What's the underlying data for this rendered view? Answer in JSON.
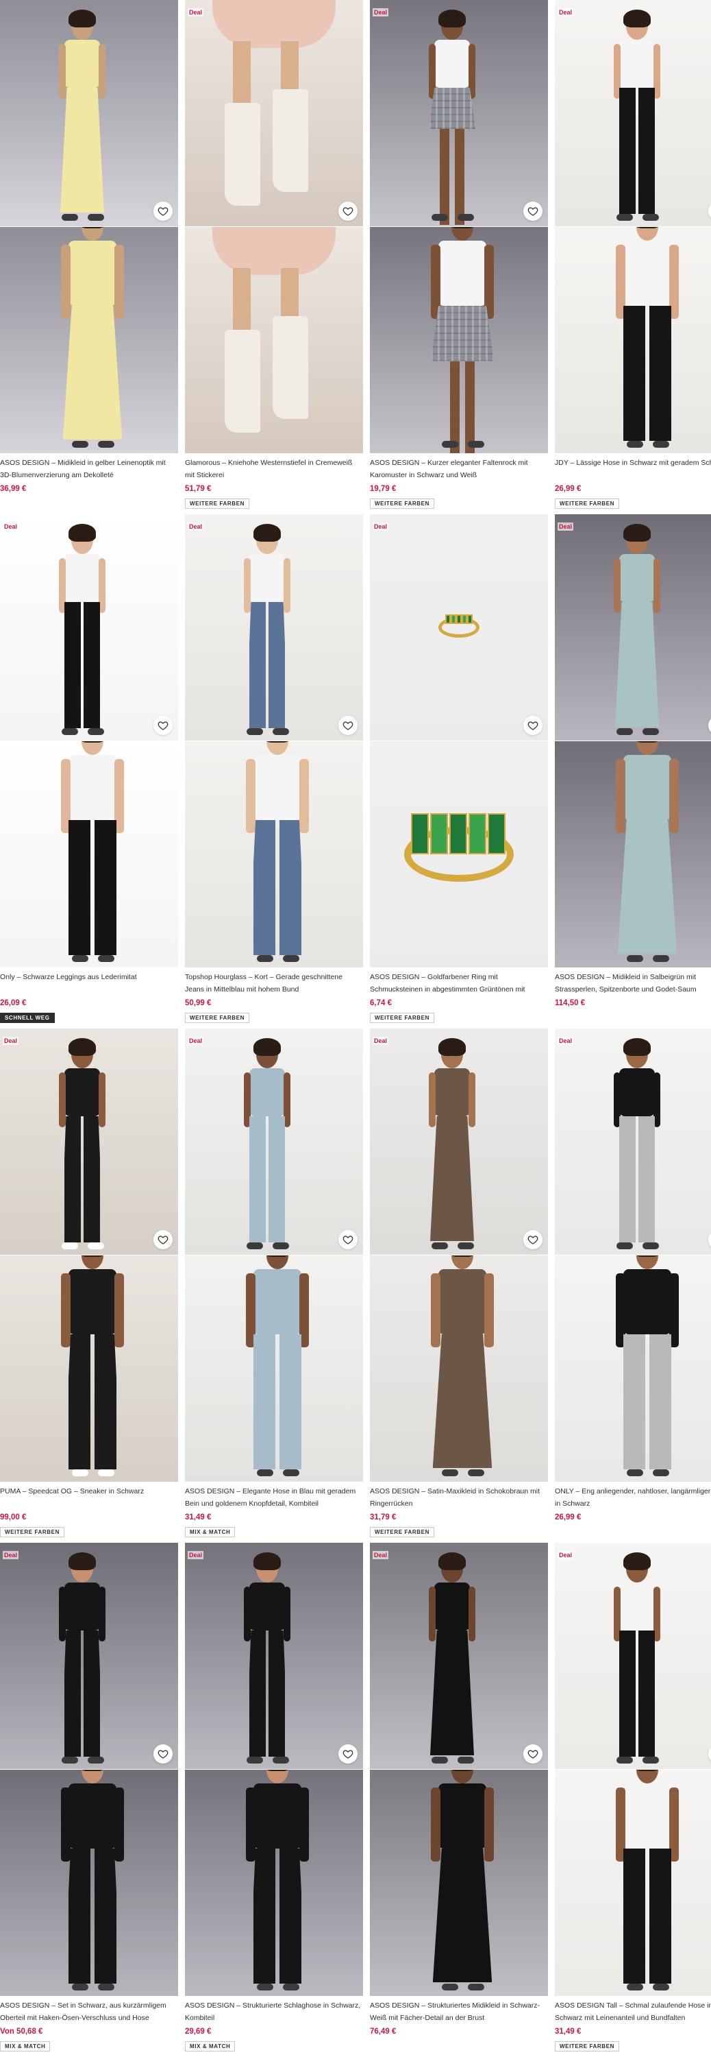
{
  "badge_label": "Deal",
  "icons": {
    "save": "heart-icon"
  },
  "colors": {
    "price": "#d01345",
    "text": "#2d2d2d"
  },
  "products": [
    {
      "id": 1,
      "deal": false,
      "title": "ASOS DESIGN – Midikleid in gelber Leinenoptik mit 3D-Blumenverzierung am Dekolleté",
      "price": "36,99 €",
      "tag": "",
      "bg": [
        "#8f8d96",
        "#d7d5da"
      ],
      "tone": "#f1e7a3",
      "skin": "#c9a07c",
      "style": "dress"
    },
    {
      "id": 2,
      "deal": true,
      "title": "Glamorous – Kniehohe Westernstiefel in Cremeweiß mit Stickerei",
      "price": "51,79 €",
      "tag": "WEITERE FARBEN",
      "bg": [
        "#ece6e1",
        "#d6c9be"
      ],
      "tone": "#f1ece4",
      "skin": "#d9b08e",
      "style": "boots"
    },
    {
      "id": 3,
      "deal": true,
      "title": "ASOS DESIGN – Kurzer eleganter Faltenrock mit Karomuster in Schwarz und Weiß",
      "price": "19,79 €",
      "tag": "WEITERE FARBEN",
      "bg": [
        "#77747d",
        "#c7c4cb"
      ],
      "tone": "#8d8f96",
      "skin": "#7b5236",
      "style": "skirt"
    },
    {
      "id": 4,
      "deal": true,
      "title": "JDY – Lässige Hose in Schwarz mit geradem Schnitt",
      "price": "26,99 €",
      "tag": "WEITERE FARBEN",
      "bg": [
        "#f6f5f3",
        "#e8e6e2"
      ],
      "tone": "#151515",
      "skin": "#d8a888",
      "style": "pants"
    },
    {
      "id": 5,
      "deal": true,
      "title": "Only – Schwarze Leggings aus Lederimitat",
      "price": "26,09 €",
      "tag": "SCHNELL WEG",
      "bg": [
        "#ffffff",
        "#f4f4f4"
      ],
      "tone": "#141414",
      "skin": "#e0b899",
      "style": "leggings"
    },
    {
      "id": 6,
      "deal": true,
      "title": "Topshop Hourglass – Kort – Gerade geschnittene Jeans in Mittelblau mit hohem Bund",
      "price": "50,99 €",
      "tag": "WEITERE FARBEN",
      "bg": [
        "#f3f2f0",
        "#e6e4e0"
      ],
      "tone": "#5b7396",
      "skin": "#e2bd9c",
      "style": "jeans"
    },
    {
      "id": 7,
      "deal": true,
      "title": "ASOS DESIGN – Goldfarbener Ring mit Schmucksteinen in abgestimmten Grüntönen mit Baguetteschliff",
      "price": "6,74 €",
      "tag": "WEITERE FARBEN",
      "bg": [
        "#f0f0f0",
        "#ebebeb"
      ],
      "tone": "#2f8f3c",
      "skin": "#d4a93e",
      "style": "ring"
    },
    {
      "id": 8,
      "deal": true,
      "title": "ASOS DESIGN – Midikleid in Salbeigrün mit Strassperlen, Spitzenborte und Godet-Saum",
      "price": "114,50 €",
      "tag": "",
      "bg": [
        "#6f6d76",
        "#b9b6bf"
      ],
      "tone": "#a9c3c2",
      "skin": "#a87654",
      "style": "dress"
    },
    {
      "id": 9,
      "deal": true,
      "title": "PUMA – Speedcat OG – Sneaker in Schwarz",
      "price": "99,00 €",
      "tag": "WEITERE FARBEN",
      "bg": [
        "#e9e5e0",
        "#d5cfc7"
      ],
      "tone": "#1b1b1b",
      "skin": "#8b5b3e",
      "style": "street"
    },
    {
      "id": 10,
      "deal": true,
      "title": "ASOS DESIGN – Elegante Hose in Blau mit geradem Bein und goldenem Knopfdetail, Kombiteil",
      "price": "31,49 €",
      "tag": "MIX & MATCH",
      "bg": [
        "#f2f2f1",
        "#e3e2df"
      ],
      "tone": "#a7bccb",
      "skin": "#7d5137",
      "style": "suit"
    },
    {
      "id": 11,
      "deal": true,
      "title": "ASOS DESIGN – Satin-Maxikleid in Schokobraun mit Ringerrücken",
      "price": "31,79 €",
      "tag": "WEITERE FARBEN",
      "bg": [
        "#ecebea",
        "#dedcd9"
      ],
      "tone": "#6c5646",
      "skin": "#a37350",
      "style": "dress"
    },
    {
      "id": 12,
      "deal": true,
      "title": "ONLY – Eng anliegender, nahtloser, langärmliger Body in Schwarz",
      "price": "26,99 €",
      "tag": "",
      "bg": [
        "#f4f4f3",
        "#e9e8e6"
      ],
      "tone": "#161616",
      "skin": "#9a6845",
      "style": "body"
    },
    {
      "id": 13,
      "deal": true,
      "title": "ASOS DESIGN – Set in Schwarz, aus kurzärmligem Oberteil mit Haken-Ösen-Verschluss und Hose",
      "price": "Von 50,68 €",
      "tag": "MIX & MATCH",
      "bg": [
        "#6f6d75",
        "#b8b5bd"
      ],
      "tone": "#151515",
      "skin": "#c59170",
      "style": "set"
    },
    {
      "id": 14,
      "deal": true,
      "title": "ASOS DESIGN – Strukturierte Schlaghose in Schwarz, Kombiteil",
      "price": "29,69 €",
      "tag": "MIX & MATCH",
      "bg": [
        "#74727a",
        "#bcb9c1"
      ],
      "tone": "#151515",
      "skin": "#c59170",
      "style": "set"
    },
    {
      "id": 15,
      "deal": true,
      "title": "ASOS DESIGN – Strukturiertes Midikleid in Schwarz-Weiß mit Fächer-Detail an der Brust",
      "price": "76,49 €",
      "tag": "",
      "bg": [
        "#7b7980",
        "#c1bec5"
      ],
      "tone": "#121212",
      "skin": "#6c452e",
      "style": "dress"
    },
    {
      "id": 16,
      "deal": true,
      "title": "ASOS DESIGN Tall – Schmal zulaufende Hose in Schwarz mit Leinenanteil und Bundfalten",
      "price": "31,49 €",
      "tag": "WEITERE FARBEN",
      "bg": [
        "#f5f5f4",
        "#eceae7"
      ],
      "tone": "#151515",
      "skin": "#8a5b3d",
      "style": "pants"
    }
  ]
}
